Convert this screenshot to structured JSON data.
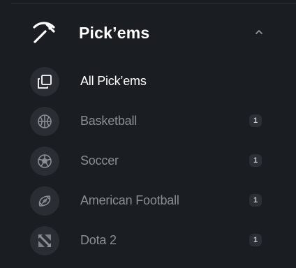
{
  "header": {
    "title": "Pick’ems",
    "icon": "pickaxe-icon",
    "chevron_icon": "chevron-up-icon"
  },
  "items": [
    {
      "label": "All Pick’ems",
      "icon": "copy-icon",
      "active": true,
      "badge": ""
    },
    {
      "label": "Basketball",
      "icon": "basketball-icon",
      "active": false,
      "badge": "1"
    },
    {
      "label": "Soccer",
      "icon": "soccer-ball-icon",
      "active": false,
      "badge": "1"
    },
    {
      "label": "American Football",
      "icon": "american-football-icon",
      "active": false,
      "badge": "1"
    },
    {
      "label": "Dota 2",
      "icon": "dota2-icon",
      "active": false,
      "badge": "1"
    }
  ],
  "colors": {
    "background": "#1a1d21",
    "icon_bg": "#2a2d33",
    "active_text": "#ffffff",
    "inactive_text": "#8a8e95",
    "badge_bg": "#2c3036"
  }
}
